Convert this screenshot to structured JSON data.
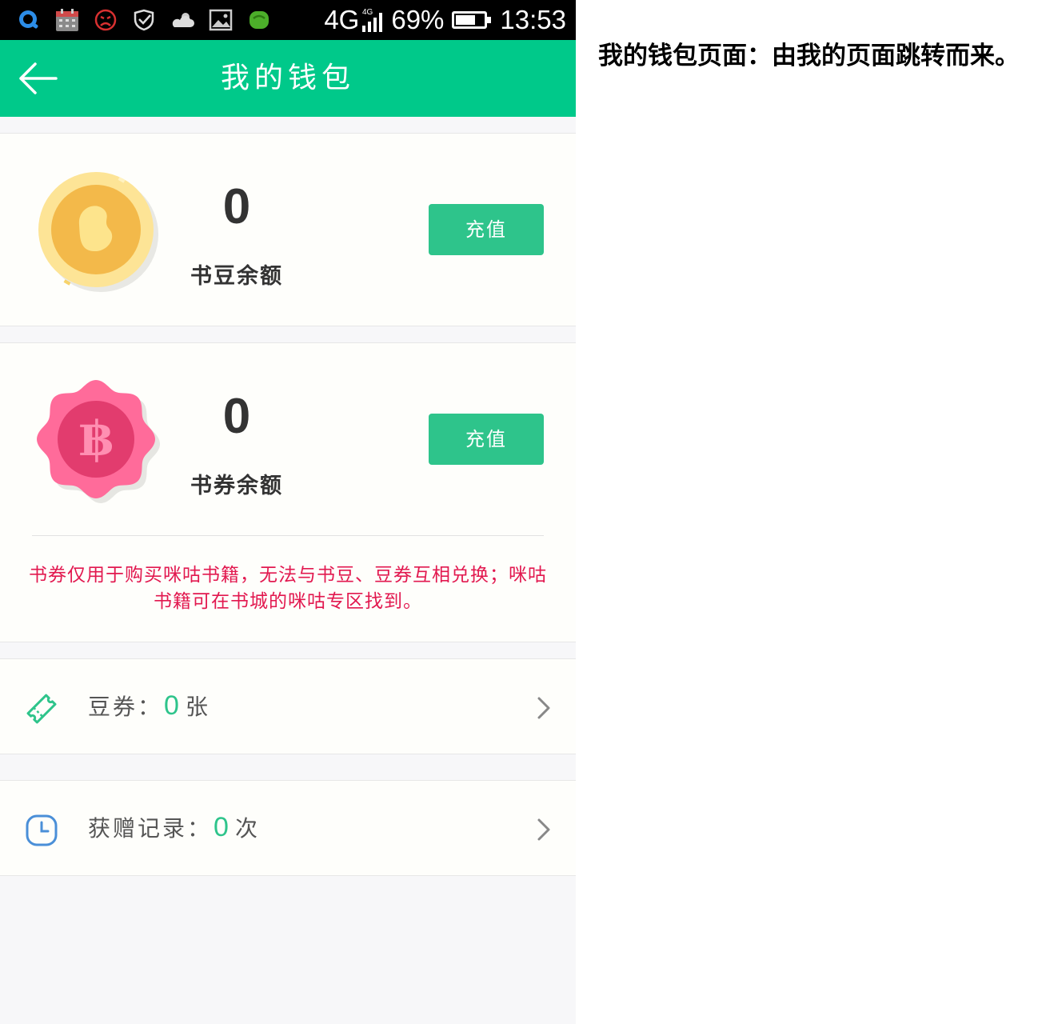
{
  "status_bar": {
    "network": "4G",
    "network_badge": "4G",
    "battery": "69%",
    "time": "13:53",
    "battery_level": 0.69,
    "notification_icons": [
      "q-app-icon",
      "calendar-icon",
      "sad-face-icon",
      "shield-check-icon",
      "cloud-icon",
      "image-icon",
      "green-app-icon"
    ]
  },
  "app_bar": {
    "title": "我的钱包"
  },
  "bean_card": {
    "value": "0",
    "label": "书豆余额",
    "button_label": "充值"
  },
  "voucher_card": {
    "value": "0",
    "label": "书券余额",
    "button_label": "充值",
    "notice": "书券仅用于购买咪咕书籍，无法与书豆、豆券互相兑换；咪咕书籍可在书城的咪咕专区找到。"
  },
  "rows": [
    {
      "label": "豆券：",
      "count": "0",
      "unit": "张"
    },
    {
      "label": "获赠记录：",
      "count": "0",
      "unit": "次"
    }
  ],
  "caption": "我的钱包页面：由我的页面跳转而来。",
  "colors": {
    "brand_green": "#00c98a",
    "button_green": "#2ec48b",
    "notice_red": "#e2184f",
    "coin_gold": "#f3b94a",
    "badge_pink": "#ff6b9a"
  }
}
